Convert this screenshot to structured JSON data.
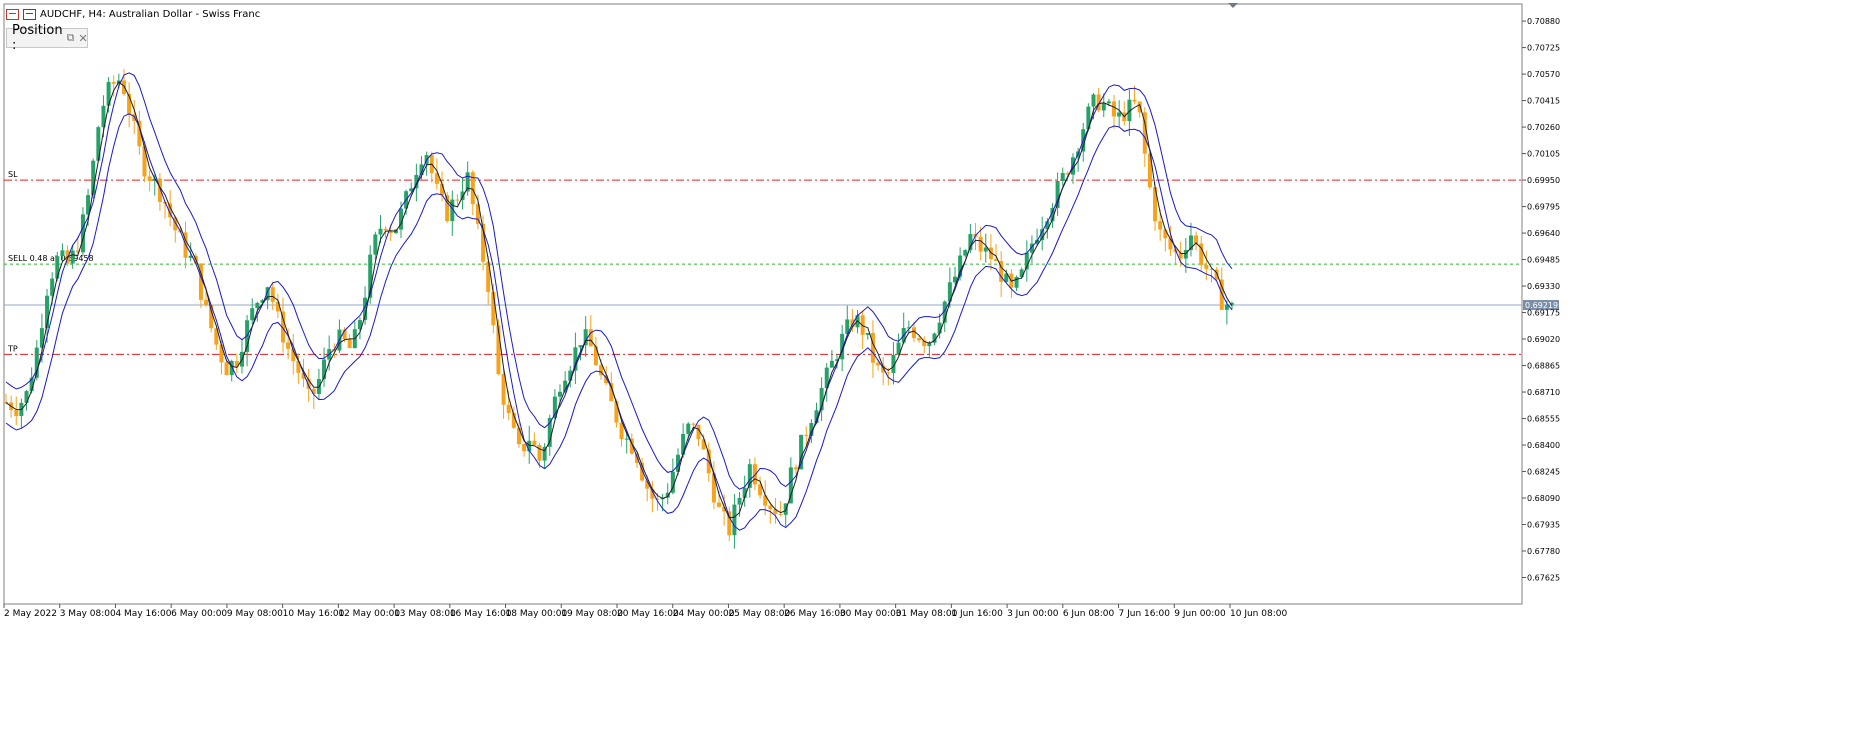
{
  "window": {
    "title": "AUDCHF, H4:  Australian Dollar - Swiss Franc",
    "position_panel_label": "Position :",
    "restore_icon": "restore-icon",
    "close_icon": "close-icon"
  },
  "colors": {
    "bull": "#26a269",
    "bear": "#f7a21b",
    "ma_fast": "#c0392b",
    "envelope": "#1a1acc",
    "sl_tp": "#e02020",
    "entry": "#2eb82e",
    "price_line": "#8fa8c8",
    "price_tag_bg": "#7a8ea8"
  },
  "chart_data": {
    "type": "candlestick",
    "symbol": "AUDCHF",
    "timeframe": "H4",
    "ylim": [
      0.6747,
      0.7098
    ],
    "y_ticks": [
      "0.70880",
      "0.70725",
      "0.70570",
      "0.70415",
      "0.70260",
      "0.70105",
      "0.69950",
      "0.69795",
      "0.69640",
      "0.69485",
      "0.69330",
      "0.69175",
      "0.69020",
      "0.68865",
      "0.68710",
      "0.68555",
      "0.68400",
      "0.68245",
      "0.68090",
      "0.67935",
      "0.67780",
      "0.67625"
    ],
    "x_labels": [
      "2 May 2022",
      "3 May 08:00",
      "4 May 16:00",
      "6 May 00:00",
      "9 May 08:00",
      "10 May 16:00",
      "12 May 00:00",
      "13 May 08:00",
      "16 May 16:00",
      "18 May 00:00",
      "19 May 08:00",
      "20 May 16:00",
      "24 May 00:00",
      "25 May 08:00",
      "26 May 16:00",
      "30 May 00:00",
      "31 May 08:00",
      "1 Jun 16:00",
      "3 Jun 00:00",
      "6 Jun 08:00",
      "7 Jun 16:00",
      "9 Jun 00:00",
      "10 Jun 08:00"
    ],
    "current_price": "0.69219",
    "levels": [
      {
        "name": "SL",
        "label": "SL",
        "price": 0.6995
      },
      {
        "name": "SELL",
        "label": "SELL 0.48 at 0.69458",
        "price": 0.69458
      },
      {
        "name": "TP",
        "label": "TP",
        "price": 0.6893
      }
    ],
    "close_path": [
      0.6865,
      0.6862,
      0.687,
      0.6898,
      0.6935,
      0.695,
      0.6945,
      0.696,
      0.699,
      0.7035,
      0.705,
      0.7055,
      0.703,
      0.7005,
      0.6995,
      0.6985,
      0.6968,
      0.6955,
      0.6945,
      0.692,
      0.69,
      0.6885,
      0.689,
      0.691,
      0.6925,
      0.6935,
      0.6912,
      0.6895,
      0.6882,
      0.6865,
      0.688,
      0.69,
      0.6902,
      0.6895,
      0.692,
      0.6955,
      0.6972,
      0.6965,
      0.698,
      0.7,
      0.7015,
      0.699,
      0.6975,
      0.6985,
      0.6998,
      0.6965,
      0.6935,
      0.688,
      0.6855,
      0.6835,
      0.6845,
      0.683,
      0.6858,
      0.688,
      0.689,
      0.6905,
      0.6895,
      0.6875,
      0.686,
      0.6845,
      0.6838,
      0.6818,
      0.6805,
      0.6812,
      0.6832,
      0.685,
      0.6848,
      0.6825,
      0.6802,
      0.679,
      0.681,
      0.6828,
      0.6815,
      0.6805,
      0.68,
      0.6825,
      0.6842,
      0.686,
      0.6875,
      0.689,
      0.6905,
      0.6915,
      0.6905,
      0.6885,
      0.6878,
      0.6895,
      0.691,
      0.6905,
      0.69,
      0.6915,
      0.693,
      0.6945,
      0.6962,
      0.6955,
      0.695,
      0.694,
      0.6928,
      0.694,
      0.696,
      0.6972,
      0.6985,
      0.6998,
      0.7012,
      0.703,
      0.7042,
      0.7038,
      0.703,
      0.7036,
      0.704,
      0.6995,
      0.6965,
      0.6955,
      0.695,
      0.6965,
      0.695,
      0.6938,
      0.6925,
      0.692
    ]
  }
}
